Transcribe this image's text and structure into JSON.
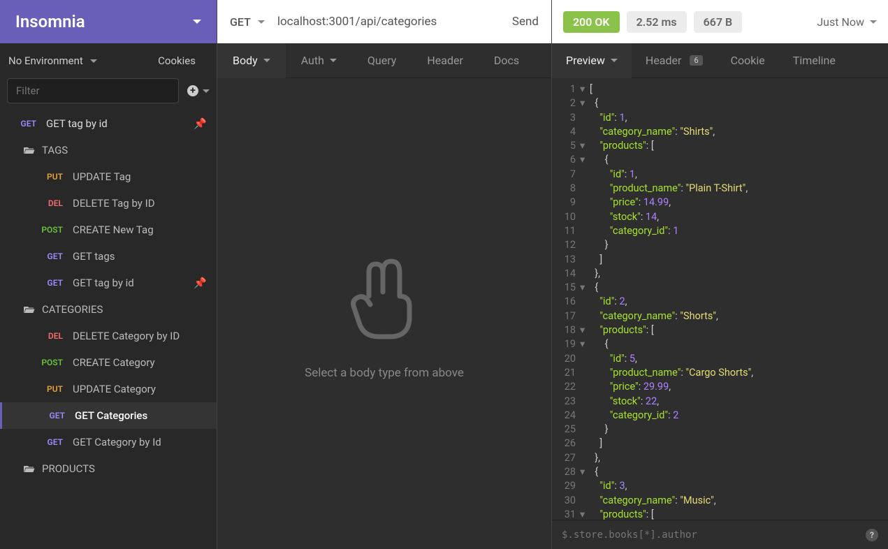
{
  "app": {
    "title": "Insomnia"
  },
  "sidebar": {
    "environment_label": "No Environment",
    "cookies_label": "Cookies",
    "filter_placeholder": "Filter",
    "top_request": {
      "method": "GET",
      "label": "GET tag by id"
    },
    "folders": [
      {
        "name": "TAGS",
        "items": [
          {
            "method": "PUT",
            "label": "UPDATE Tag"
          },
          {
            "method": "DEL",
            "label": "DELETE Tag by ID"
          },
          {
            "method": "POST",
            "label": "CREATE New Tag"
          },
          {
            "method": "GET",
            "label": "GET tags"
          },
          {
            "method": "GET",
            "label": "GET tag by id",
            "pinned": true
          }
        ]
      },
      {
        "name": "CATEGORIES",
        "items": [
          {
            "method": "DEL",
            "label": "DELETE Category by ID"
          },
          {
            "method": "POST",
            "label": "CREATE Category"
          },
          {
            "method": "PUT",
            "label": "UPDATE Category"
          },
          {
            "method": "GET",
            "label": "GET Categories",
            "active": true
          },
          {
            "method": "GET",
            "label": "GET Category by Id"
          }
        ]
      },
      {
        "name": "PRODUCTS",
        "items": []
      }
    ]
  },
  "request": {
    "method": "GET",
    "url": "localhost:3001/api/categories",
    "send_label": "Send",
    "tabs": {
      "body": "Body",
      "auth": "Auth",
      "query": "Query",
      "header": "Header",
      "docs": "Docs"
    },
    "body_empty_text": "Select a body type from above"
  },
  "response": {
    "status": "200 OK",
    "time": "2.52 ms",
    "size": "667 B",
    "time_label": "Just Now",
    "tabs": {
      "preview": "Preview",
      "header": "Header",
      "header_badge": "6",
      "cookie": "Cookie",
      "timeline": "Timeline"
    },
    "jsonpath_placeholder": "$.store.books[*].author",
    "json_lines": [
      {
        "n": 1,
        "fold": "▾",
        "indent": 0,
        "tokens": [
          {
            "t": "punc",
            "v": "["
          }
        ]
      },
      {
        "n": 2,
        "fold": "▾",
        "indent": 1,
        "tokens": [
          {
            "t": "punc",
            "v": "{"
          }
        ]
      },
      {
        "n": 3,
        "fold": "",
        "indent": 2,
        "tokens": [
          {
            "t": "key",
            "v": "\"id\""
          },
          {
            "t": "punc",
            "v": ": "
          },
          {
            "t": "num",
            "v": "1"
          },
          {
            "t": "punc",
            "v": ","
          }
        ]
      },
      {
        "n": 4,
        "fold": "",
        "indent": 2,
        "tokens": [
          {
            "t": "key",
            "v": "\"category_name\""
          },
          {
            "t": "punc",
            "v": ": "
          },
          {
            "t": "str",
            "v": "\"Shirts\""
          },
          {
            "t": "punc",
            "v": ","
          }
        ]
      },
      {
        "n": 5,
        "fold": "▾",
        "indent": 2,
        "tokens": [
          {
            "t": "key",
            "v": "\"products\""
          },
          {
            "t": "punc",
            "v": ": ["
          }
        ]
      },
      {
        "n": 6,
        "fold": "▾",
        "indent": 3,
        "tokens": [
          {
            "t": "punc",
            "v": "{"
          }
        ]
      },
      {
        "n": 7,
        "fold": "",
        "indent": 4,
        "tokens": [
          {
            "t": "key",
            "v": "\"id\""
          },
          {
            "t": "punc",
            "v": ": "
          },
          {
            "t": "num",
            "v": "1"
          },
          {
            "t": "punc",
            "v": ","
          }
        ]
      },
      {
        "n": 8,
        "fold": "",
        "indent": 4,
        "tokens": [
          {
            "t": "key",
            "v": "\"product_name\""
          },
          {
            "t": "punc",
            "v": ": "
          },
          {
            "t": "str",
            "v": "\"Plain T-Shirt\""
          },
          {
            "t": "punc",
            "v": ","
          }
        ]
      },
      {
        "n": 9,
        "fold": "",
        "indent": 4,
        "tokens": [
          {
            "t": "key",
            "v": "\"price\""
          },
          {
            "t": "punc",
            "v": ": "
          },
          {
            "t": "num",
            "v": "14.99"
          },
          {
            "t": "punc",
            "v": ","
          }
        ]
      },
      {
        "n": 10,
        "fold": "",
        "indent": 4,
        "tokens": [
          {
            "t": "key",
            "v": "\"stock\""
          },
          {
            "t": "punc",
            "v": ": "
          },
          {
            "t": "num",
            "v": "14"
          },
          {
            "t": "punc",
            "v": ","
          }
        ]
      },
      {
        "n": 11,
        "fold": "",
        "indent": 4,
        "tokens": [
          {
            "t": "key",
            "v": "\"category_id\""
          },
          {
            "t": "punc",
            "v": ": "
          },
          {
            "t": "num",
            "v": "1"
          }
        ]
      },
      {
        "n": 12,
        "fold": "",
        "indent": 3,
        "tokens": [
          {
            "t": "punc",
            "v": "}"
          }
        ]
      },
      {
        "n": 13,
        "fold": "",
        "indent": 2,
        "tokens": [
          {
            "t": "punc",
            "v": "]"
          }
        ]
      },
      {
        "n": 14,
        "fold": "",
        "indent": 1,
        "tokens": [
          {
            "t": "punc",
            "v": "},"
          }
        ]
      },
      {
        "n": 15,
        "fold": "▾",
        "indent": 1,
        "tokens": [
          {
            "t": "punc",
            "v": "{"
          }
        ]
      },
      {
        "n": 16,
        "fold": "",
        "indent": 2,
        "tokens": [
          {
            "t": "key",
            "v": "\"id\""
          },
          {
            "t": "punc",
            "v": ": "
          },
          {
            "t": "num",
            "v": "2"
          },
          {
            "t": "punc",
            "v": ","
          }
        ]
      },
      {
        "n": 17,
        "fold": "",
        "indent": 2,
        "tokens": [
          {
            "t": "key",
            "v": "\"category_name\""
          },
          {
            "t": "punc",
            "v": ": "
          },
          {
            "t": "str",
            "v": "\"Shorts\""
          },
          {
            "t": "punc",
            "v": ","
          }
        ]
      },
      {
        "n": 18,
        "fold": "▾",
        "indent": 2,
        "tokens": [
          {
            "t": "key",
            "v": "\"products\""
          },
          {
            "t": "punc",
            "v": ": ["
          }
        ]
      },
      {
        "n": 19,
        "fold": "▾",
        "indent": 3,
        "tokens": [
          {
            "t": "punc",
            "v": "{"
          }
        ]
      },
      {
        "n": 20,
        "fold": "",
        "indent": 4,
        "tokens": [
          {
            "t": "key",
            "v": "\"id\""
          },
          {
            "t": "punc",
            "v": ": "
          },
          {
            "t": "num",
            "v": "5"
          },
          {
            "t": "punc",
            "v": ","
          }
        ]
      },
      {
        "n": 21,
        "fold": "",
        "indent": 4,
        "tokens": [
          {
            "t": "key",
            "v": "\"product_name\""
          },
          {
            "t": "punc",
            "v": ": "
          },
          {
            "t": "str",
            "v": "\"Cargo Shorts\""
          },
          {
            "t": "punc",
            "v": ","
          }
        ]
      },
      {
        "n": 22,
        "fold": "",
        "indent": 4,
        "tokens": [
          {
            "t": "key",
            "v": "\"price\""
          },
          {
            "t": "punc",
            "v": ": "
          },
          {
            "t": "num",
            "v": "29.99"
          },
          {
            "t": "punc",
            "v": ","
          }
        ]
      },
      {
        "n": 23,
        "fold": "",
        "indent": 4,
        "tokens": [
          {
            "t": "key",
            "v": "\"stock\""
          },
          {
            "t": "punc",
            "v": ": "
          },
          {
            "t": "num",
            "v": "22"
          },
          {
            "t": "punc",
            "v": ","
          }
        ]
      },
      {
        "n": 24,
        "fold": "",
        "indent": 4,
        "tokens": [
          {
            "t": "key",
            "v": "\"category_id\""
          },
          {
            "t": "punc",
            "v": ": "
          },
          {
            "t": "num",
            "v": "2"
          }
        ]
      },
      {
        "n": 25,
        "fold": "",
        "indent": 3,
        "tokens": [
          {
            "t": "punc",
            "v": "}"
          }
        ]
      },
      {
        "n": 26,
        "fold": "",
        "indent": 2,
        "tokens": [
          {
            "t": "punc",
            "v": "]"
          }
        ]
      },
      {
        "n": 27,
        "fold": "",
        "indent": 1,
        "tokens": [
          {
            "t": "punc",
            "v": "},"
          }
        ]
      },
      {
        "n": 28,
        "fold": "▾",
        "indent": 1,
        "tokens": [
          {
            "t": "punc",
            "v": "{"
          }
        ]
      },
      {
        "n": 29,
        "fold": "",
        "indent": 2,
        "tokens": [
          {
            "t": "key",
            "v": "\"id\""
          },
          {
            "t": "punc",
            "v": ": "
          },
          {
            "t": "num",
            "v": "3"
          },
          {
            "t": "punc",
            "v": ","
          }
        ]
      },
      {
        "n": 30,
        "fold": "",
        "indent": 2,
        "tokens": [
          {
            "t": "key",
            "v": "\"category_name\""
          },
          {
            "t": "punc",
            "v": ": "
          },
          {
            "t": "str",
            "v": "\"Music\""
          },
          {
            "t": "punc",
            "v": ","
          }
        ]
      },
      {
        "n": 31,
        "fold": "▾",
        "indent": 2,
        "tokens": [
          {
            "t": "key",
            "v": "\"products\""
          },
          {
            "t": "punc",
            "v": ": ["
          }
        ]
      }
    ]
  }
}
